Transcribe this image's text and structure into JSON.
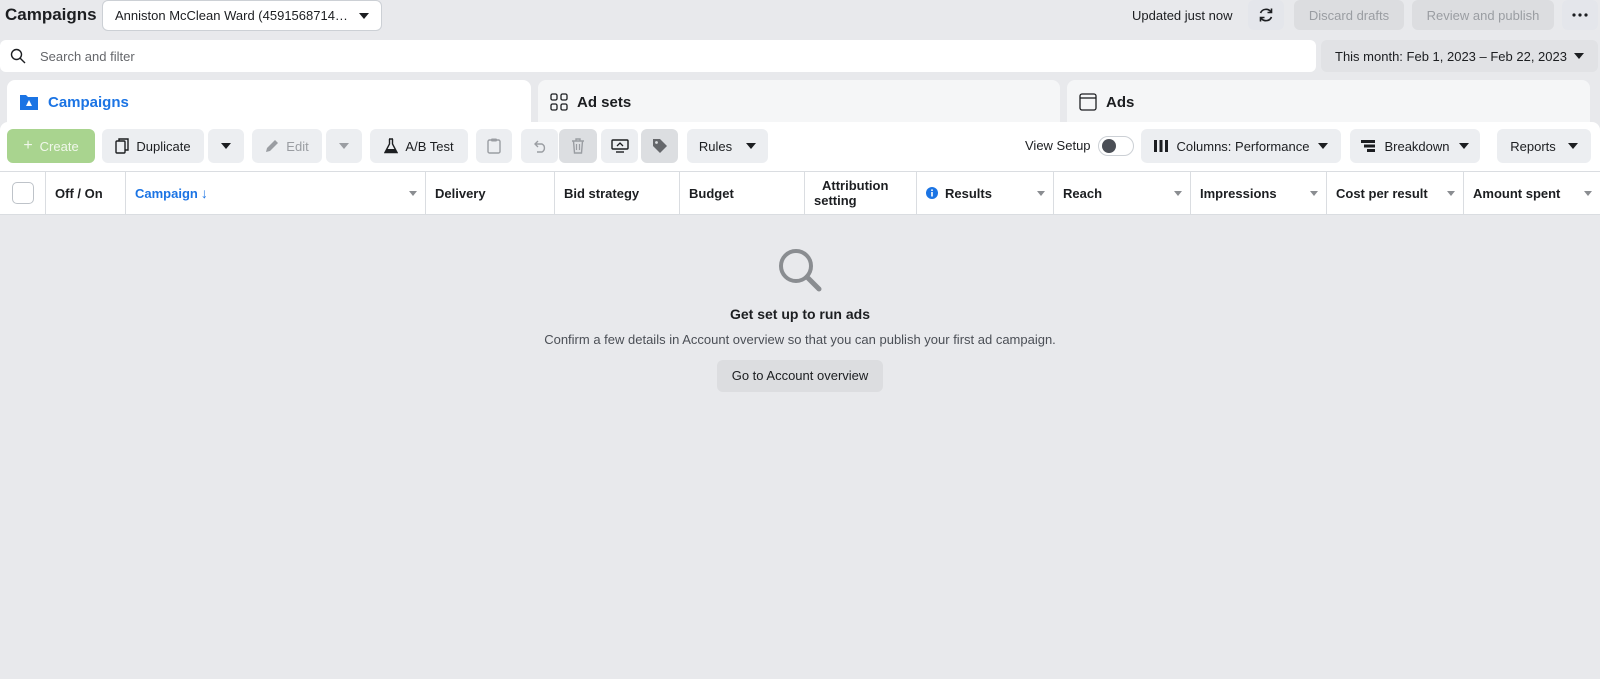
{
  "header": {
    "title": "Campaigns",
    "account": "Anniston McClean Ward (4591568714…",
    "updated": "Updated just now",
    "discard": "Discard drafts",
    "review": "Review and publish"
  },
  "search": {
    "placeholder": "Search and filter"
  },
  "date_range": "This month: Feb 1, 2023 – Feb 22, 2023",
  "tabs": [
    {
      "label": "Campaigns",
      "icon": "folder-icon"
    },
    {
      "label": "Ad sets",
      "icon": "grid-icon"
    },
    {
      "label": "Ads",
      "icon": "ad-window-icon"
    }
  ],
  "toolbar": {
    "create": "Create",
    "duplicate": "Duplicate",
    "edit": "Edit",
    "ab_test": "A/B Test",
    "rules": "Rules",
    "view_setup": "View Setup",
    "columns": "Columns: Performance",
    "breakdown": "Breakdown",
    "reports": "Reports"
  },
  "columns": {
    "off_on": "Off / On",
    "campaign": "Campaign",
    "delivery": "Delivery",
    "bid_strategy": "Bid strategy",
    "budget": "Budget",
    "attribution_1": "Attribution",
    "attribution_2": "setting",
    "results": "Results",
    "reach": "Reach",
    "impressions": "Impressions",
    "cost_per_result": "Cost per result",
    "amount_spent": "Amount spent"
  },
  "empty_state": {
    "title": "Get set up to run ads",
    "description": "Confirm a few details in Account overview so that you can publish your first ad campaign.",
    "button": "Go to Account overview"
  },
  "colors": {
    "accent": "#1b74e4",
    "create_green": "#a9d48f"
  }
}
